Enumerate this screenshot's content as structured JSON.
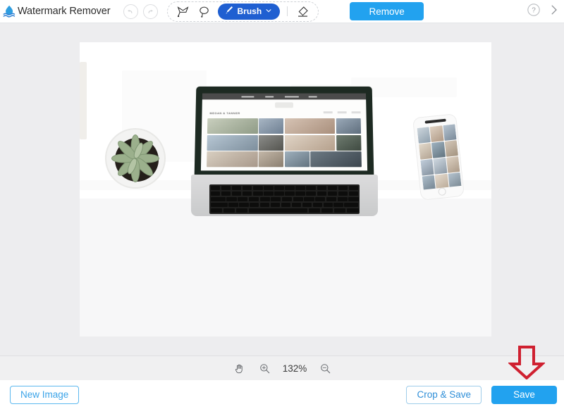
{
  "app": {
    "title": "Watermark Remover",
    "logo_icon": "water-drop-wave-logo"
  },
  "toolbar": {
    "undo_icon": "undo-arrow-icon",
    "redo_icon": "redo-arrow-icon",
    "tools": [
      {
        "icon": "lasso-polygon-icon",
        "name": "polygon-lasso-tool"
      },
      {
        "icon": "lasso-freehand-icon",
        "name": "freehand-lasso-tool"
      }
    ],
    "brush": {
      "label": "Brush",
      "icon": "brush-icon",
      "chevron_icon": "chevron-down-icon",
      "color": "#1f5fd1"
    },
    "eraser_icon": "eraser-icon",
    "remove_label": "Remove",
    "remove_color": "#22a2ef",
    "help_icon": "question-mark-circle-icon",
    "collapse_icon": "chevron-right-icon"
  },
  "canvas": {
    "background": "#ededef",
    "image": {
      "alt": "Flat lay desk photo with succulent plant, laptop showing photo gallery website, and white smartphone",
      "site_title": "MEGAN & TANNER",
      "erased_region": "top white area where watermark was removed"
    }
  },
  "zoombar": {
    "hand_icon": "hand-pan-icon",
    "zoom_in_icon": "zoom-in-magnifier-icon",
    "zoom_level": "132%",
    "zoom_out_icon": "zoom-out-magnifier-icon"
  },
  "bottombar": {
    "new_image_label": "New Image",
    "crop_save_label": "Crop & Save",
    "save_label": "Save",
    "save_color": "#22a2ef",
    "outline_color": "#5cb8ef"
  },
  "annotation": {
    "arrow_icon": "red-down-arrow-annotation",
    "color": "#cf2030",
    "points_at": "Save"
  }
}
